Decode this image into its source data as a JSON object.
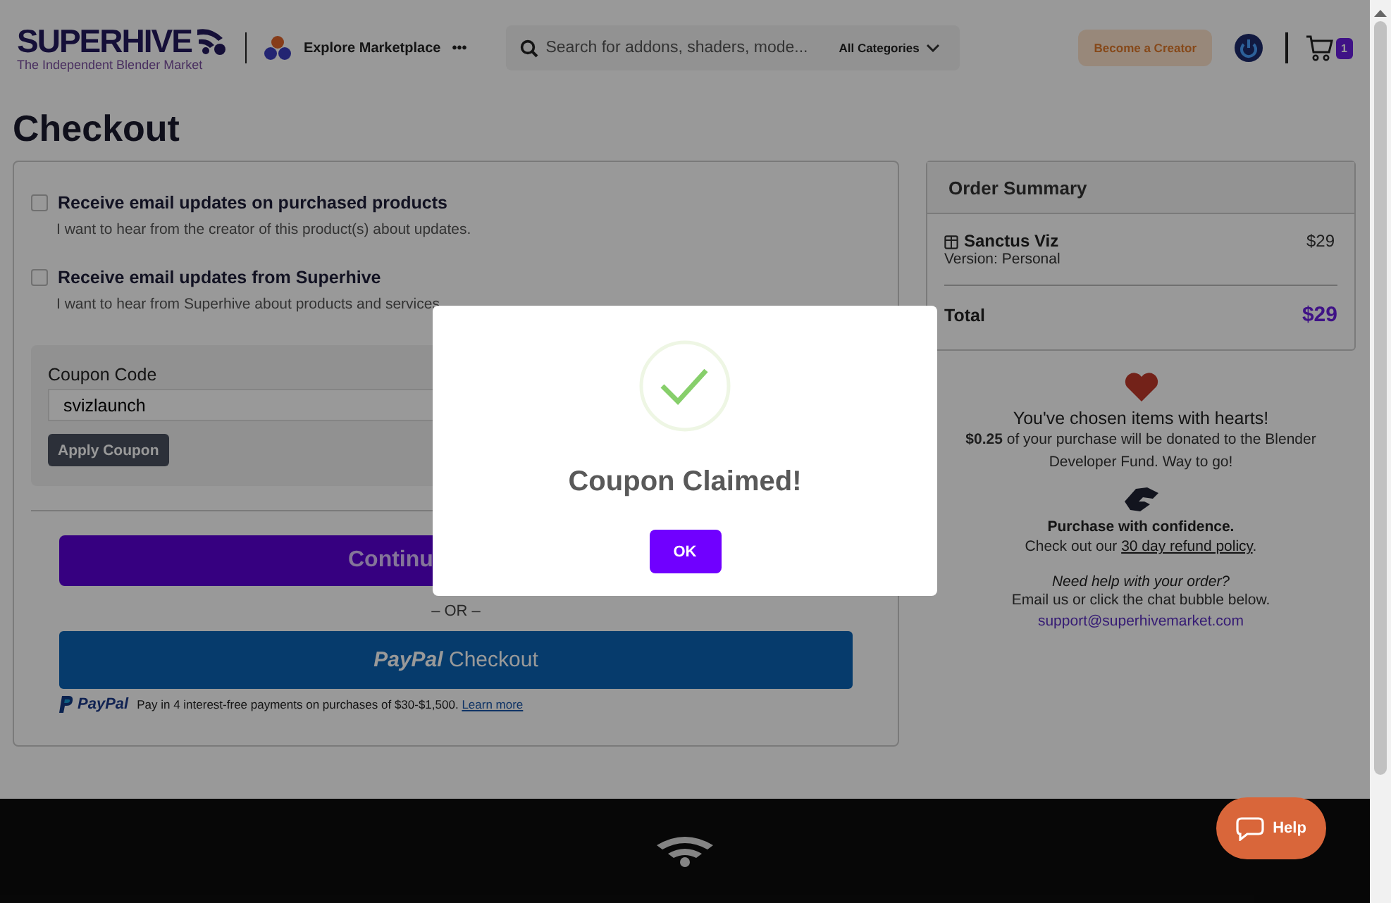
{
  "header": {
    "logo": "SUPERHIVE",
    "tagline": "The Independent Blender Market",
    "explore": "Explore Marketplace",
    "more": "•••",
    "search": {
      "placeholder": "Search for addons, shaders, mode..."
    },
    "category": "All Categories",
    "creator_button": "Become a Creator",
    "cart_count": "1"
  },
  "page_title": "Checkout",
  "options": [
    {
      "label": "Receive email updates on purchased products",
      "description": "I want to hear from the creator of this product(s) about updates.",
      "checked": false
    },
    {
      "label": "Receive email updates from Superhive",
      "description": "I want to hear from Superhive about products and services",
      "checked": false
    }
  ],
  "coupon": {
    "label": "Coupon Code",
    "value": "svizlaunch",
    "button": "Apply Coupon"
  },
  "continue_button": "Continu",
  "separator": "– OR –",
  "paypal": {
    "button_brand": "PayPal",
    "button_label": "Checkout",
    "brand": "PayPal",
    "note": "Pay in 4 interest-free payments on purchases of $30-$1,500.",
    "link": "Learn more"
  },
  "order_summary": {
    "title": "Order Summary",
    "items": [
      {
        "name": "Sanctus Viz",
        "version": "Version: Personal",
        "price": "$29"
      }
    ],
    "total_label": "Total",
    "total": "$29"
  },
  "charity": {
    "heading": "You've chosen items with hearts!",
    "text": "**$0.25** of your purchase will be donated to the Blender Developer Fund. Way to go!"
  },
  "confidence": {
    "heading": "Purchase with confidence.",
    "text": "Check out our",
    "link": "30 day refund policy",
    "end": "."
  },
  "support": {
    "question": "Need help with your order?",
    "text": "Email us or click the chat bubble below.",
    "email": "support@superhivemarket.com"
  },
  "dialog": {
    "title": "Coupon Claimed!",
    "button": "OK"
  },
  "help_button": "Help"
}
